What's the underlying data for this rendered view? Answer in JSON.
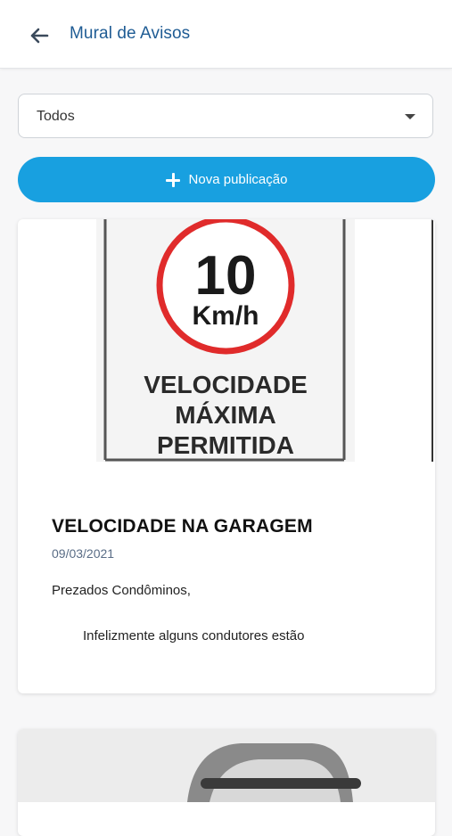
{
  "header": {
    "title": "Mural de Avisos",
    "back_icon": "arrow-left-icon"
  },
  "filter": {
    "selected": "Todos"
  },
  "actions": {
    "new_post_label": "Nova publicação",
    "new_post_icon": "plus-icon"
  },
  "posts": [
    {
      "image": {
        "speed": "10",
        "unit": "Km/h",
        "line1": "VELOCIDADE",
        "line2": "MÁXIMA",
        "line3": "PERMITIDA"
      },
      "title": "VELOCIDADE NA GARAGEM",
      "date": "09/03/2021",
      "greeting": "Prezados Condôminos,",
      "excerpt": "Infelizmente alguns condutores estão"
    }
  ],
  "colors": {
    "primary": "#18a0e0",
    "title_blue": "#1f5c94",
    "date_gray": "#5a6d86",
    "sign_red": "#e02b2b"
  }
}
